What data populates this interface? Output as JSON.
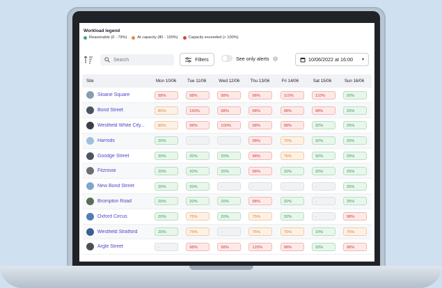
{
  "legend": {
    "title": "Workload legend",
    "items": [
      {
        "label": "Reasonable (0 - 79%)",
        "color": "#3fa66a"
      },
      {
        "label": "At capacity (80 - 100%)",
        "color": "#e48a3f"
      },
      {
        "label": "Capacity exceeded (> 100%)",
        "color": "#d9433b"
      }
    ]
  },
  "toolbar": {
    "search_placeholder": "Search",
    "filters_label": "Filters",
    "alerts_label": "See only alerts",
    "date_label": "10/06/2022 at 16:00"
  },
  "table": {
    "site_header": "Site",
    "days": [
      "Mon 10/06",
      "Tue 11/06",
      "Wed 12/06",
      "Thu 13/06",
      "Fri 14/06",
      "Sat 15/06",
      "Sun 16/06"
    ],
    "rows": [
      {
        "site": "Sloane Square",
        "thumb": "#8a9bb0",
        "cells": [
          [
            "98%",
            "r"
          ],
          [
            "98%",
            "r"
          ],
          [
            "98%",
            "r"
          ],
          [
            "98%",
            "r"
          ],
          [
            "110%",
            "r"
          ],
          [
            "110%",
            "r"
          ],
          [
            "20%",
            "g"
          ]
        ]
      },
      {
        "site": "Bond Street",
        "thumb": "#4a5360",
        "cells": [
          [
            "85%",
            "o"
          ],
          [
            "150%",
            "r"
          ],
          [
            "98%",
            "r"
          ],
          [
            "98%",
            "r"
          ],
          [
            "98%",
            "r"
          ],
          [
            "98%",
            "r"
          ],
          [
            "25%",
            "g"
          ]
        ]
      },
      {
        "site": "Westfield White City...",
        "thumb": "#3a3f47",
        "cells": [
          [
            "85%",
            "o"
          ],
          [
            "98%",
            "r"
          ],
          [
            "100%",
            "r"
          ],
          [
            "98%",
            "r"
          ],
          [
            "98%",
            "r"
          ],
          [
            "32%",
            "g"
          ],
          [
            "25%",
            "g"
          ]
        ]
      },
      {
        "site": "Harrods",
        "thumb": "#9fc0dc",
        "cells": [
          [
            "20%",
            "g"
          ],
          [
            "-",
            "n"
          ],
          [
            "-",
            "n"
          ],
          [
            "98%",
            "r"
          ],
          [
            "75%",
            "o"
          ],
          [
            "32%",
            "g"
          ],
          [
            "25%",
            "g"
          ]
        ]
      },
      {
        "site": "Goodge Street",
        "thumb": "#4d5562",
        "cells": [
          [
            "20%",
            "g"
          ],
          [
            "20%",
            "g"
          ],
          [
            "20%",
            "g"
          ],
          [
            "98%",
            "r"
          ],
          [
            "75%",
            "o"
          ],
          [
            "32%",
            "g"
          ],
          [
            "25%",
            "g"
          ]
        ]
      },
      {
        "site": "Fitzrovia",
        "thumb": "#6e6e72",
        "cells": [
          [
            "20%",
            "g"
          ],
          [
            "20%",
            "g"
          ],
          [
            "20%",
            "g"
          ],
          [
            "98%",
            "r"
          ],
          [
            "32%",
            "g"
          ],
          [
            "32%",
            "g"
          ],
          [
            "25%",
            "g"
          ]
        ]
      },
      {
        "site": "New Bond Street",
        "thumb": "#7fa6c9",
        "cells": [
          [
            "20%",
            "g"
          ],
          [
            "20%",
            "g"
          ],
          [
            "-",
            "n"
          ],
          [
            "-",
            "n"
          ],
          [
            "-",
            "n"
          ],
          [
            "-",
            "n"
          ],
          [
            "25%",
            "g"
          ]
        ]
      },
      {
        "site": "Brompton Road",
        "thumb": "#5b6b58",
        "cells": [
          [
            "20%",
            "g"
          ],
          [
            "20%",
            "g"
          ],
          [
            "20%",
            "g"
          ],
          [
            "98%",
            "r"
          ],
          [
            "32%",
            "g"
          ],
          [
            "-",
            "n"
          ],
          [
            "25%",
            "g"
          ]
        ]
      },
      {
        "site": "Oxford Circus",
        "thumb": "#4f7fb8",
        "cells": [
          [
            "20%",
            "g"
          ],
          [
            "75%",
            "o"
          ],
          [
            "20%",
            "g"
          ],
          [
            "75%",
            "o"
          ],
          [
            "32%",
            "g"
          ],
          [
            "-",
            "n"
          ],
          [
            "98%",
            "r"
          ]
        ]
      },
      {
        "site": "Westfield Stratford",
        "thumb": "#3d5f8f",
        "cells": [
          [
            "20%",
            "g"
          ],
          [
            "75%",
            "o"
          ],
          [
            "-",
            "n"
          ],
          [
            "75%",
            "o"
          ],
          [
            "75%",
            "o"
          ],
          [
            "10%",
            "g"
          ],
          [
            "75%",
            "o"
          ]
        ]
      },
      {
        "site": "Argle Street",
        "thumb": "#4a4f58",
        "cells": [
          [
            "-",
            "n"
          ],
          [
            "98%",
            "r"
          ],
          [
            "98%",
            "r"
          ],
          [
            "120%",
            "r"
          ],
          [
            "98%",
            "r"
          ],
          [
            "20%",
            "g"
          ],
          [
            "98%",
            "r"
          ]
        ]
      }
    ]
  }
}
